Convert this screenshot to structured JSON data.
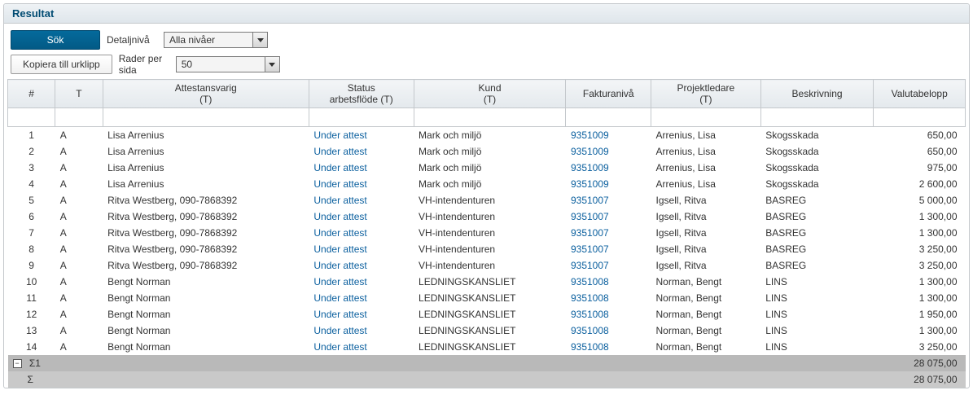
{
  "panel": {
    "title": "Resultat"
  },
  "controls": {
    "search_label": "Sök",
    "copy_label": "Kopiera till urklipp",
    "detail_label": "Detaljnivå",
    "detail_value": "Alla nivåer",
    "rows_label1": "Rader per",
    "rows_label2": "sida",
    "rows_value": "50"
  },
  "columns": {
    "idx": "#",
    "t": "T",
    "attest": "Attestansvarig",
    "attest_sub": "(T)",
    "status": "Status",
    "status_sub": "arbetsflöde (T)",
    "kund": "Kund",
    "kund_sub": "(T)",
    "faktura": "Fakturanivå",
    "projekt": "Projektledare",
    "projekt_sub": "(T)",
    "beskr": "Beskrivning",
    "belopp": "Valutabelopp"
  },
  "rows": [
    {
      "n": "1",
      "t": "A",
      "attest": "Lisa Arrenius",
      "status": "Under attest",
      "kund": "Mark och miljö",
      "faktura": "9351009",
      "proj": "Arrenius, Lisa",
      "beskr": "Skogsskada",
      "belopp": "650,00"
    },
    {
      "n": "2",
      "t": "A",
      "attest": "Lisa Arrenius",
      "status": "Under attest",
      "kund": "Mark och miljö",
      "faktura": "9351009",
      "proj": "Arrenius, Lisa",
      "beskr": "Skogsskada",
      "belopp": "650,00"
    },
    {
      "n": "3",
      "t": "A",
      "attest": "Lisa Arrenius",
      "status": "Under attest",
      "kund": "Mark och miljö",
      "faktura": "9351009",
      "proj": "Arrenius, Lisa",
      "beskr": "Skogsskada",
      "belopp": "975,00"
    },
    {
      "n": "4",
      "t": "A",
      "attest": "Lisa Arrenius",
      "status": "Under attest",
      "kund": "Mark och miljö",
      "faktura": "9351009",
      "proj": "Arrenius, Lisa",
      "beskr": "Skogsskada",
      "belopp": "2 600,00"
    },
    {
      "n": "5",
      "t": "A",
      "attest": "Ritva Westberg, 090-7868392",
      "status": "Under attest",
      "kund": "VH-intendenturen",
      "faktura": "9351007",
      "proj": "Igsell, Ritva",
      "beskr": "BASREG",
      "belopp": "5 000,00"
    },
    {
      "n": "6",
      "t": "A",
      "attest": "Ritva Westberg, 090-7868392",
      "status": "Under attest",
      "kund": "VH-intendenturen",
      "faktura": "9351007",
      "proj": "Igsell, Ritva",
      "beskr": "BASREG",
      "belopp": "1 300,00"
    },
    {
      "n": "7",
      "t": "A",
      "attest": "Ritva Westberg, 090-7868392",
      "status": "Under attest",
      "kund": "VH-intendenturen",
      "faktura": "9351007",
      "proj": "Igsell, Ritva",
      "beskr": "BASREG",
      "belopp": "1 300,00"
    },
    {
      "n": "8",
      "t": "A",
      "attest": "Ritva Westberg, 090-7868392",
      "status": "Under attest",
      "kund": "VH-intendenturen",
      "faktura": "9351007",
      "proj": "Igsell, Ritva",
      "beskr": "BASREG",
      "belopp": "3 250,00"
    },
    {
      "n": "9",
      "t": "A",
      "attest": "Ritva Westberg, 090-7868392",
      "status": "Under attest",
      "kund": "VH-intendenturen",
      "faktura": "9351007",
      "proj": "Igsell, Ritva",
      "beskr": "BASREG",
      "belopp": "3 250,00"
    },
    {
      "n": "10",
      "t": "A",
      "attest": "Bengt Norman",
      "status": "Under attest",
      "kund": "LEDNINGSKANSLIET",
      "faktura": "9351008",
      "proj": "Norman, Bengt",
      "beskr": "LINS",
      "belopp": "1 300,00"
    },
    {
      "n": "11",
      "t": "A",
      "attest": "Bengt Norman",
      "status": "Under attest",
      "kund": "LEDNINGSKANSLIET",
      "faktura": "9351008",
      "proj": "Norman, Bengt",
      "beskr": "LINS",
      "belopp": "1 300,00"
    },
    {
      "n": "12",
      "t": "A",
      "attest": "Bengt Norman",
      "status": "Under attest",
      "kund": "LEDNINGSKANSLIET",
      "faktura": "9351008",
      "proj": "Norman, Bengt",
      "beskr": "LINS",
      "belopp": "1 950,00"
    },
    {
      "n": "13",
      "t": "A",
      "attest": "Bengt Norman",
      "status": "Under attest",
      "kund": "LEDNINGSKANSLIET",
      "faktura": "9351008",
      "proj": "Norman, Bengt",
      "beskr": "LINS",
      "belopp": "1 300,00"
    },
    {
      "n": "14",
      "t": "A",
      "attest": "Bengt Norman",
      "status": "Under attest",
      "kund": "LEDNINGSKANSLIET",
      "faktura": "9351008",
      "proj": "Norman, Bengt",
      "beskr": "LINS",
      "belopp": "3 250,00"
    }
  ],
  "sums": {
    "sigma1_label": "Σ1",
    "sigma_label": "Σ",
    "sigma1_value": "28 075,00",
    "sigma_value": "28 075,00",
    "toggle_glyph": "−"
  }
}
